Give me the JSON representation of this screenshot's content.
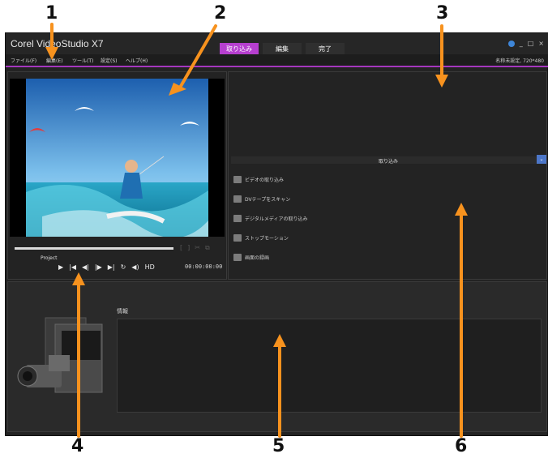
{
  "app": {
    "title": "Corel VideoStudio X7",
    "tabs": [
      {
        "label": "取り込み"
      },
      {
        "label": "編集"
      },
      {
        "label": "完了"
      }
    ],
    "window_controls": {
      "minimize": "_",
      "maximize": "□",
      "close": "×"
    }
  },
  "menu": {
    "items": [
      {
        "label": "ファイル(F)"
      },
      {
        "label": "編集(E)"
      },
      {
        "label": "ツール(T)"
      },
      {
        "label": "設定(S)"
      },
      {
        "label": "ヘルプ(H)"
      }
    ],
    "project_setting": "名称未設定, 720*480"
  },
  "player": {
    "project_label": "Project",
    "timecode": "00:00:00:00",
    "controls": [
      "▶",
      "|◀",
      "◀|",
      "|▶",
      "▶|",
      "↻",
      "◀)",
      "HD"
    ],
    "small_icons": [
      "[",
      "]",
      "✂",
      "⧉"
    ]
  },
  "capture": {
    "title": "取り込み",
    "collapse_icon": "⌄",
    "items": [
      {
        "label": "ビデオの取り込み"
      },
      {
        "label": "DVテープをスキャン"
      },
      {
        "label": "デジタルメディアの取り込み"
      },
      {
        "label": "ストップモーション"
      },
      {
        "label": "画面の録画"
      }
    ]
  },
  "info": {
    "label": "情報"
  },
  "callouts": [
    "1",
    "2",
    "3",
    "4",
    "5",
    "6"
  ],
  "colors": {
    "accent": "#b63fcf",
    "arrow": "#f7921e",
    "background": "#232323"
  }
}
